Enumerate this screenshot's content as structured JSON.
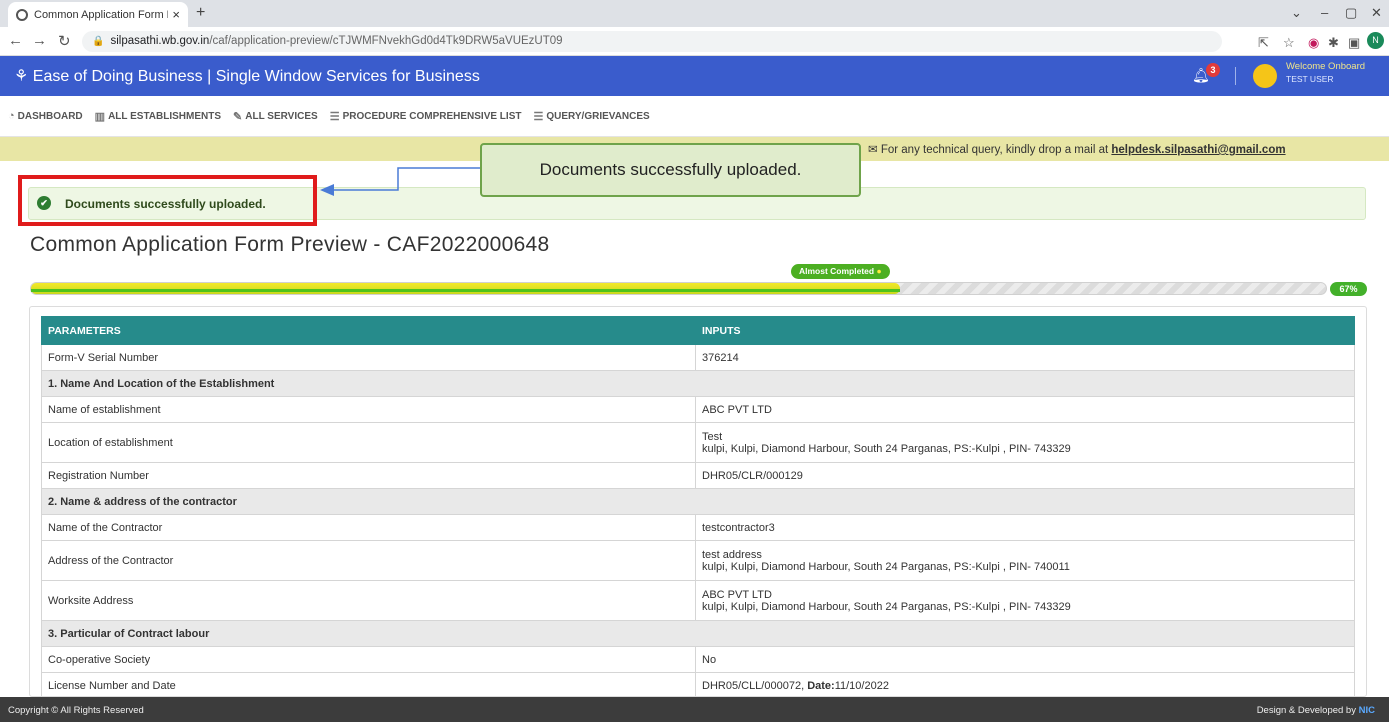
{
  "browser": {
    "tab_title": "Common Application Form Previ",
    "tab_close": "×",
    "new_tab": "+",
    "url_host": "silpasathi.wb.gov.in",
    "url_path": "/caf/application-preview/cTJWMFNvekhGd0d4Tk9DRW5aVUEzUT09",
    "profile_initial": "N"
  },
  "header": {
    "title": "Ease of Doing Business | Single Window Services for Business",
    "notification_count": "3",
    "welcome": "Welcome Onboard",
    "username": "TEST USER"
  },
  "menu": [
    {
      "label": "DASHBOARD",
      "icon": "dashboard-icon"
    },
    {
      "label": "ALL ESTABLISHMENTS",
      "icon": "building-icon"
    },
    {
      "label": "ALL SERVICES",
      "icon": "wrench-icon"
    },
    {
      "label": "PROCEDURE COMPREHENSIVE LIST",
      "icon": "list-icon"
    },
    {
      "label": "QUERY/GRIEVANCES",
      "icon": "list-icon"
    }
  ],
  "helpdesk": {
    "text": "For any technical query, kindly drop a mail at",
    "email": "helpdesk.silpasathi@gmail.com"
  },
  "alert": {
    "message": "Documents successfully uploaded."
  },
  "callout": {
    "text": "Documents successfully uploaded."
  },
  "page": {
    "title": "Common Application Form Preview - CAF2022000648"
  },
  "progress": {
    "label": "Almost Completed",
    "percent_text": "67%",
    "fraction": 0.67
  },
  "table": {
    "headers": [
      "PARAMETERS",
      "INPUTS"
    ],
    "rows": [
      {
        "type": "row",
        "param": "Form-V Serial Number",
        "value": "376214"
      },
      {
        "type": "section",
        "title": "1. Name And Location of the Establishment"
      },
      {
        "type": "row",
        "param": "Name of establishment",
        "value": "ABC PVT LTD"
      },
      {
        "type": "row",
        "param": "Location of establishment",
        "value": "Test",
        "value2": "kulpi, Kulpi, Diamond Harbour, South 24 Parganas, PS:-Kulpi , PIN- 743329"
      },
      {
        "type": "row",
        "param": "Registration Number",
        "value": "DHR05/CLR/000129"
      },
      {
        "type": "section",
        "title": "2. Name & address of the contractor"
      },
      {
        "type": "row",
        "param": "Name of the Contractor",
        "value": "testcontractor3"
      },
      {
        "type": "row",
        "param": "Address of the Contractor",
        "value": "test address",
        "value2": "kulpi, Kulpi, Diamond Harbour, South 24 Parganas, PS:-Kulpi , PIN- 740011"
      },
      {
        "type": "row",
        "param": "Worksite Address",
        "value": "ABC PVT LTD",
        "value2": "kulpi, Kulpi, Diamond Harbour, South 24 Parganas, PS:-Kulpi , PIN- 743329"
      },
      {
        "type": "section",
        "title": "3. Particular of Contract labour"
      },
      {
        "type": "row",
        "param": "Co-operative Society",
        "value": "No"
      },
      {
        "type": "row",
        "param": "License Number and Date",
        "value": "DHR05/CLL/000072, ",
        "bold_label": "Date:",
        "value_after": "11/10/2022"
      }
    ]
  },
  "footer": {
    "copyright": "Copyright © All Rights Reserved",
    "design": "Design & Developed by",
    "nic": "NIC"
  }
}
